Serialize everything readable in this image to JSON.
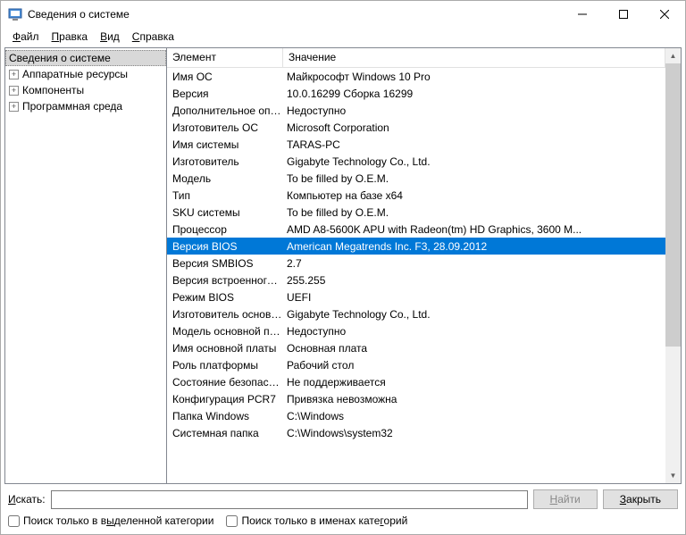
{
  "window": {
    "title": "Сведения о системе"
  },
  "menu": {
    "file": "Файл",
    "edit": "Правка",
    "view": "Вид",
    "help": "Справка",
    "file_u": "Ф",
    "edit_u": "П",
    "view_u": "В",
    "help_u": "С",
    "file_rest": "айл",
    "edit_rest": "равка",
    "view_rest": "ид",
    "help_rest": "правка"
  },
  "tree": {
    "root": "Сведения о системе",
    "items": [
      "Аппаратные ресурсы",
      "Компоненты",
      "Программная среда"
    ]
  },
  "columns": {
    "element": "Элемент",
    "value": "Значение"
  },
  "rows": [
    {
      "k": "Имя ОС",
      "v": "Майкрософт Windows 10 Pro"
    },
    {
      "k": "Версия",
      "v": "10.0.16299 Сборка 16299"
    },
    {
      "k": "Дополнительное опис...",
      "v": "Недоступно"
    },
    {
      "k": "Изготовитель ОС",
      "v": "Microsoft Corporation"
    },
    {
      "k": "Имя системы",
      "v": "TARAS-PC"
    },
    {
      "k": "Изготовитель",
      "v": "Gigabyte Technology Co., Ltd."
    },
    {
      "k": "Модель",
      "v": "To be filled by O.E.M."
    },
    {
      "k": "Тип",
      "v": "Компьютер на базе x64"
    },
    {
      "k": "SKU системы",
      "v": "To be filled by O.E.M."
    },
    {
      "k": "Процессор",
      "v": "AMD A8-5600K APU with Radeon(tm) HD Graphics, 3600 М..."
    },
    {
      "k": "Версия BIOS",
      "v": "American Megatrends Inc. F3, 28.09.2012",
      "selected": true
    },
    {
      "k": "Версия SMBIOS",
      "v": "2.7"
    },
    {
      "k": "Версия встроенного к...",
      "v": "255.255"
    },
    {
      "k": "Режим BIOS",
      "v": "UEFI"
    },
    {
      "k": "Изготовитель основно...",
      "v": "Gigabyte Technology Co., Ltd."
    },
    {
      "k": "Модель основной пла...",
      "v": "Недоступно"
    },
    {
      "k": "Имя основной платы",
      "v": "Основная плата"
    },
    {
      "k": "Роль платформы",
      "v": "Рабочий стол"
    },
    {
      "k": "Состояние безопасно...",
      "v": "Не поддерживается"
    },
    {
      "k": "Конфигурация PCR7",
      "v": "Привязка невозможна"
    },
    {
      "k": "Папка Windows",
      "v": "C:\\Windows"
    },
    {
      "k": "Системная папка",
      "v": "C:\\Windows\\system32"
    }
  ],
  "footer": {
    "search_label_u": "И",
    "search_label_rest": "скать:",
    "find_u": "Н",
    "find_rest": "айти",
    "close_u": "З",
    "close_rest": "акрыть",
    "check1_pre": "Поиск только в в",
    "check1_u": "ы",
    "check1_post": "деленной категории",
    "check2_pre": "Поиск только в именах кате",
    "check2_u": "г",
    "check2_post": "орий"
  }
}
